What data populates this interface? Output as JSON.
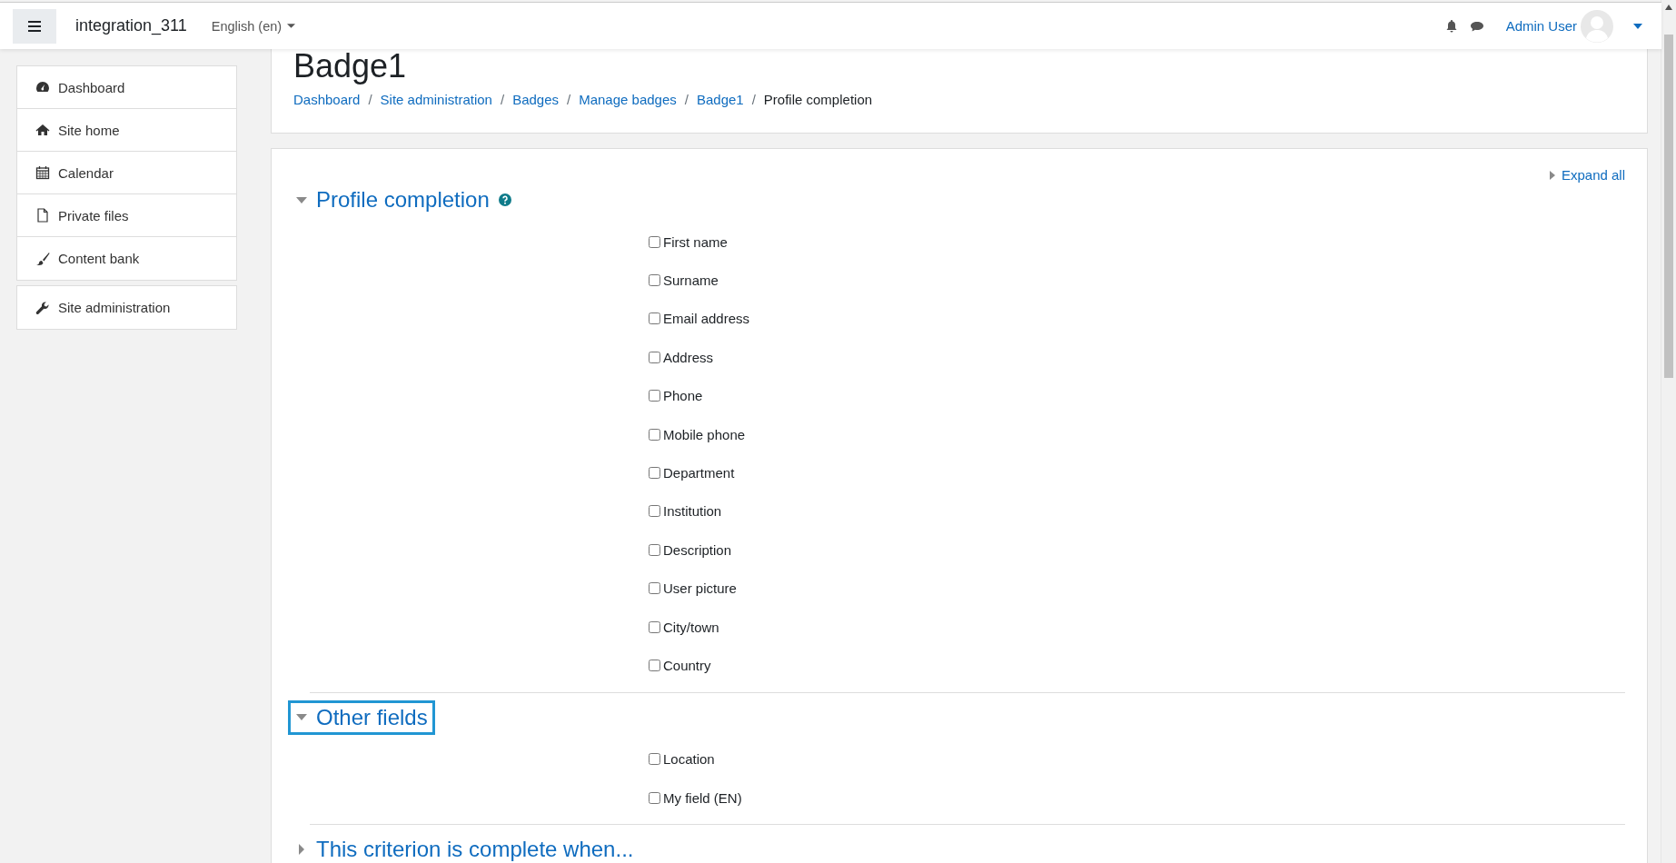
{
  "navbar": {
    "site_name": "integration_311",
    "language": "English (en)",
    "user_name": "Admin User"
  },
  "sidebar": {
    "groups": [
      {
        "items": [
          {
            "label": "Dashboard"
          },
          {
            "label": "Site home"
          },
          {
            "label": "Calendar"
          },
          {
            "label": "Private files"
          },
          {
            "label": "Content bank"
          }
        ]
      },
      {
        "items": [
          {
            "label": "Site administration"
          }
        ]
      }
    ]
  },
  "header": {
    "title": "Badge1",
    "breadcrumb": [
      {
        "label": "Dashboard",
        "link": true
      },
      {
        "separator": "/",
        "label": "Site administration",
        "link": true
      },
      {
        "separator": "/",
        "label": "Badges",
        "link": true
      },
      {
        "separator": "/",
        "label": "Manage badges",
        "link": true
      },
      {
        "separator": "/",
        "label": "Badge1",
        "link": true
      },
      {
        "separator": "/",
        "label": "Profile completion",
        "link": false
      }
    ]
  },
  "form": {
    "expand_all": "Expand all",
    "sections": [
      {
        "title": "Profile completion",
        "expanded": true,
        "help": true,
        "focused": false,
        "fields": [
          {
            "label": "First name",
            "checked": false
          },
          {
            "label": "Surname",
            "checked": false
          },
          {
            "label": "Email address",
            "checked": false
          },
          {
            "label": "Address",
            "checked": false
          },
          {
            "label": "Phone",
            "checked": false
          },
          {
            "label": "Mobile phone",
            "checked": false
          },
          {
            "label": "Department",
            "checked": false
          },
          {
            "label": "Institution",
            "checked": false
          },
          {
            "label": "Description",
            "checked": false
          },
          {
            "label": "User picture",
            "checked": false
          },
          {
            "label": "City/town",
            "checked": false
          },
          {
            "label": "Country",
            "checked": false
          }
        ]
      },
      {
        "title": "Other fields",
        "expanded": true,
        "help": false,
        "focused": true,
        "fields": [
          {
            "label": "Location",
            "checked": false
          },
          {
            "label": "My field (EN)",
            "checked": false
          }
        ]
      },
      {
        "title": "This criterion is complete when...",
        "expanded": false,
        "help": false,
        "focused": false
      }
    ]
  }
}
